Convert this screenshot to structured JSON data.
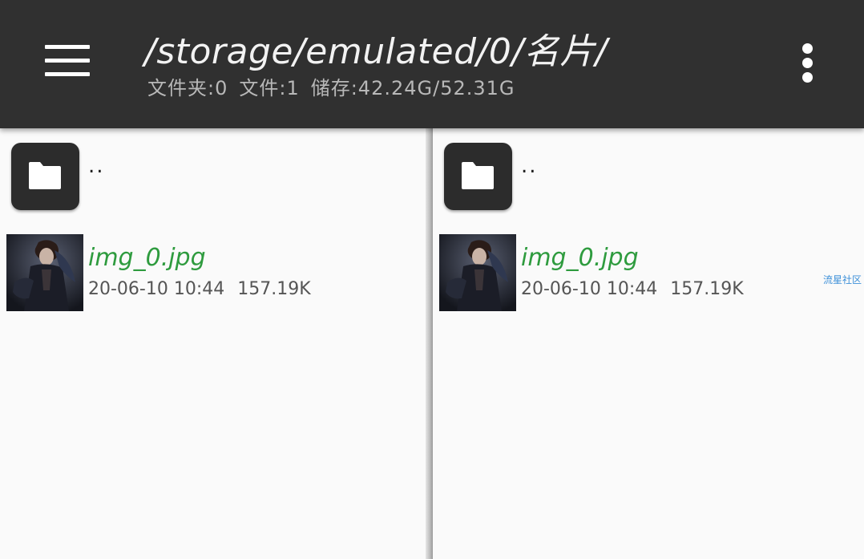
{
  "header": {
    "path": "/storage/emulated/0/名片/",
    "folders_label": "文件夹:0",
    "files_label": "文件:1",
    "storage_label": "储存:42.24G/52.31G"
  },
  "panes": [
    {
      "parent_label": "..",
      "file": {
        "name": "img_0.jpg",
        "date": "20-06-10 10:44",
        "size": "157.19K"
      }
    },
    {
      "parent_label": "..",
      "file": {
        "name": "img_0.jpg",
        "date": "20-06-10 10:44",
        "size": "157.19K"
      }
    }
  ],
  "watermark": "流星社区",
  "colors": {
    "toolbar": "#303030",
    "file_name": "#2e9b3e",
    "watermark": "#3b8fd8"
  },
  "icons": {
    "menu": "menu-icon",
    "more": "more-vert-icon",
    "folder": "folder-icon"
  }
}
